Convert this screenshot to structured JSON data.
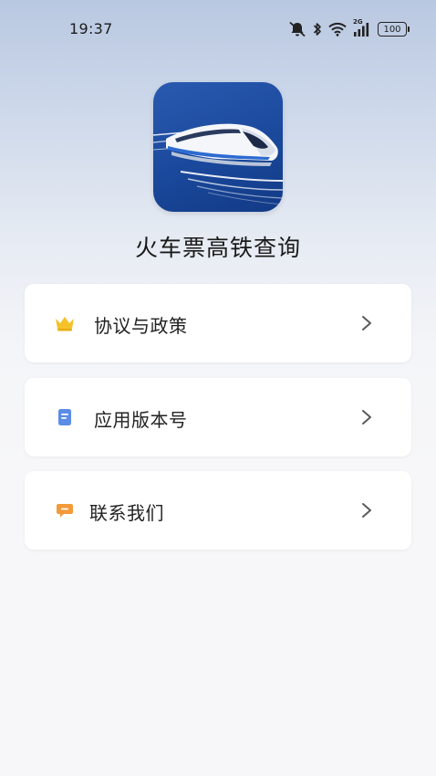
{
  "status_bar": {
    "time": "19:37",
    "network_label": "2G",
    "battery_level": "100",
    "icons": [
      "mute-icon",
      "bluetooth-icon",
      "wifi-icon",
      "cellular-signal-icon",
      "battery-icon"
    ]
  },
  "app": {
    "name": "火车票高铁查询",
    "logo_icon": "high-speed-train-logo"
  },
  "menu": {
    "items": [
      {
        "label": "协议与政策",
        "icon": "crown-icon",
        "icon_color": "#f5c22a"
      },
      {
        "label": "应用版本号",
        "icon": "document-icon",
        "icon_color": "#5b8de6"
      },
      {
        "label": "联系我们",
        "icon": "message-icon",
        "icon_color": "#f39a3a"
      }
    ]
  },
  "colors": {
    "chevron": "#5a5a5a",
    "card_background": "#ffffff",
    "header_gradient_top": "#b9c8e1"
  }
}
